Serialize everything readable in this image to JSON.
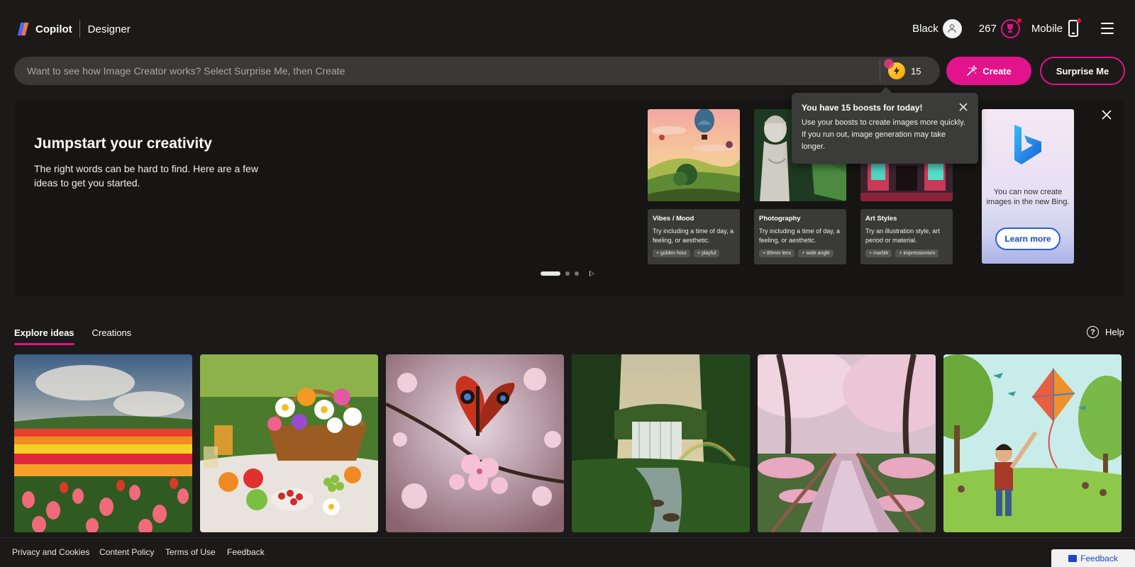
{
  "header": {
    "brand": "Copilot",
    "product": "Designer",
    "user_name": "Black",
    "points": "267",
    "mobile_label": "Mobile"
  },
  "search": {
    "placeholder": "Want to see how Image Creator works? Select Surprise Me, then Create",
    "boost_count": "15",
    "create_label": "Create",
    "surprise_label": "Surprise Me"
  },
  "tooltip": {
    "title": "You have 15 boosts for today!",
    "body": "Use your boosts to create images more quickly. If you run out, image generation may take longer."
  },
  "hero": {
    "title": "Jumpstart your creativity",
    "description": "The right words can be hard to find. Here are a few ideas to get you started.",
    "cards": [
      {
        "title": "Vibes / Mood",
        "desc": "Try including a time of day, a feeling, or aesthetic.",
        "chips": [
          "golden hour",
          "playful"
        ]
      },
      {
        "title": "Photography",
        "desc": "Try including a time of day, a feeling, or aesthetic.",
        "chips": [
          "85mm lens",
          "wide angle"
        ]
      },
      {
        "title": "Art Styles",
        "desc": "Try an illustration style, art period or material.",
        "chips": [
          "marble",
          "impressionism"
        ]
      }
    ],
    "bing_card": {
      "text": "You can now create images in the new Bing.",
      "button": "Learn more"
    }
  },
  "tabs": {
    "explore": "Explore ideas",
    "creations": "Creations",
    "help": "Help"
  },
  "footer": {
    "privacy": "Privacy and Cookies",
    "content_policy": "Content Policy",
    "terms": "Terms of Use",
    "feedback": "Feedback",
    "feedback_button": "Feedback"
  },
  "colors": {
    "accent": "#e3138b",
    "background": "#1b1a19",
    "link_blue": "#1a47c4"
  }
}
